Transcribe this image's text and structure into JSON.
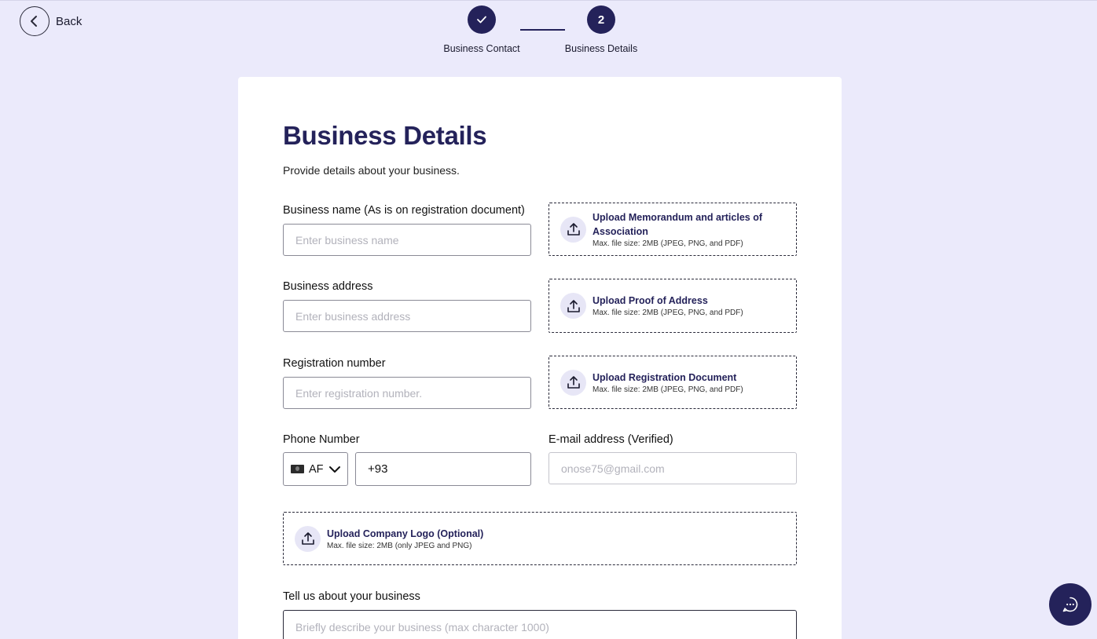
{
  "nav": {
    "back_label": "Back"
  },
  "stepper": {
    "steps": [
      {
        "label": "Business Contact",
        "number": "",
        "status": "complete"
      },
      {
        "label": "Business Details",
        "number": "2",
        "status": "current"
      }
    ]
  },
  "form": {
    "title": "Business Details",
    "subtitle": "Provide details about your business.",
    "business_name": {
      "label": "Business name (As is on registration document)",
      "placeholder": "Enter business name",
      "value": ""
    },
    "business_address": {
      "label": "Business address",
      "placeholder": "Enter business address",
      "value": ""
    },
    "registration_number": {
      "label": "Registration number",
      "placeholder": "Enter registration number.",
      "value": ""
    },
    "phone": {
      "label": "Phone Number",
      "country": "AF",
      "value": "+93"
    },
    "email": {
      "label": "E-mail address (Verified)",
      "placeholder": "onose75@gmail.com",
      "value": ""
    },
    "about": {
      "label": "Tell us about your business",
      "placeholder": "Briefly describe your business (max character 1000)",
      "value": ""
    }
  },
  "uploads": {
    "memorandum": {
      "title": "Upload Memorandum and articles of Association",
      "note": "Max. file size: 2MB (JPEG, PNG, and PDF)"
    },
    "proof_of_address": {
      "title": "Upload Proof of Address",
      "note": "Max. file size: 2MB (JPEG, PNG, and PDF)"
    },
    "registration_document": {
      "title": "Upload Registration Document",
      "note": "Max. file size: 2MB (JPEG, PNG, and PDF)"
    },
    "company_logo": {
      "title": "Upload Company Logo (Optional)",
      "note": "Max. file size: 2MB (only JPEG and PNG)"
    }
  },
  "colors": {
    "background": "#ebeafb",
    "primary": "#24225a",
    "card": "#ffffff",
    "icon_bg": "#e7e6f6"
  },
  "icons": {
    "back": "chevron-left-icon",
    "step_complete": "check-icon",
    "upload": "upload-icon",
    "country_dropdown": "chevron-down-icon",
    "flag": "flag-af-icon",
    "chat": "chat-bubble-icon"
  }
}
